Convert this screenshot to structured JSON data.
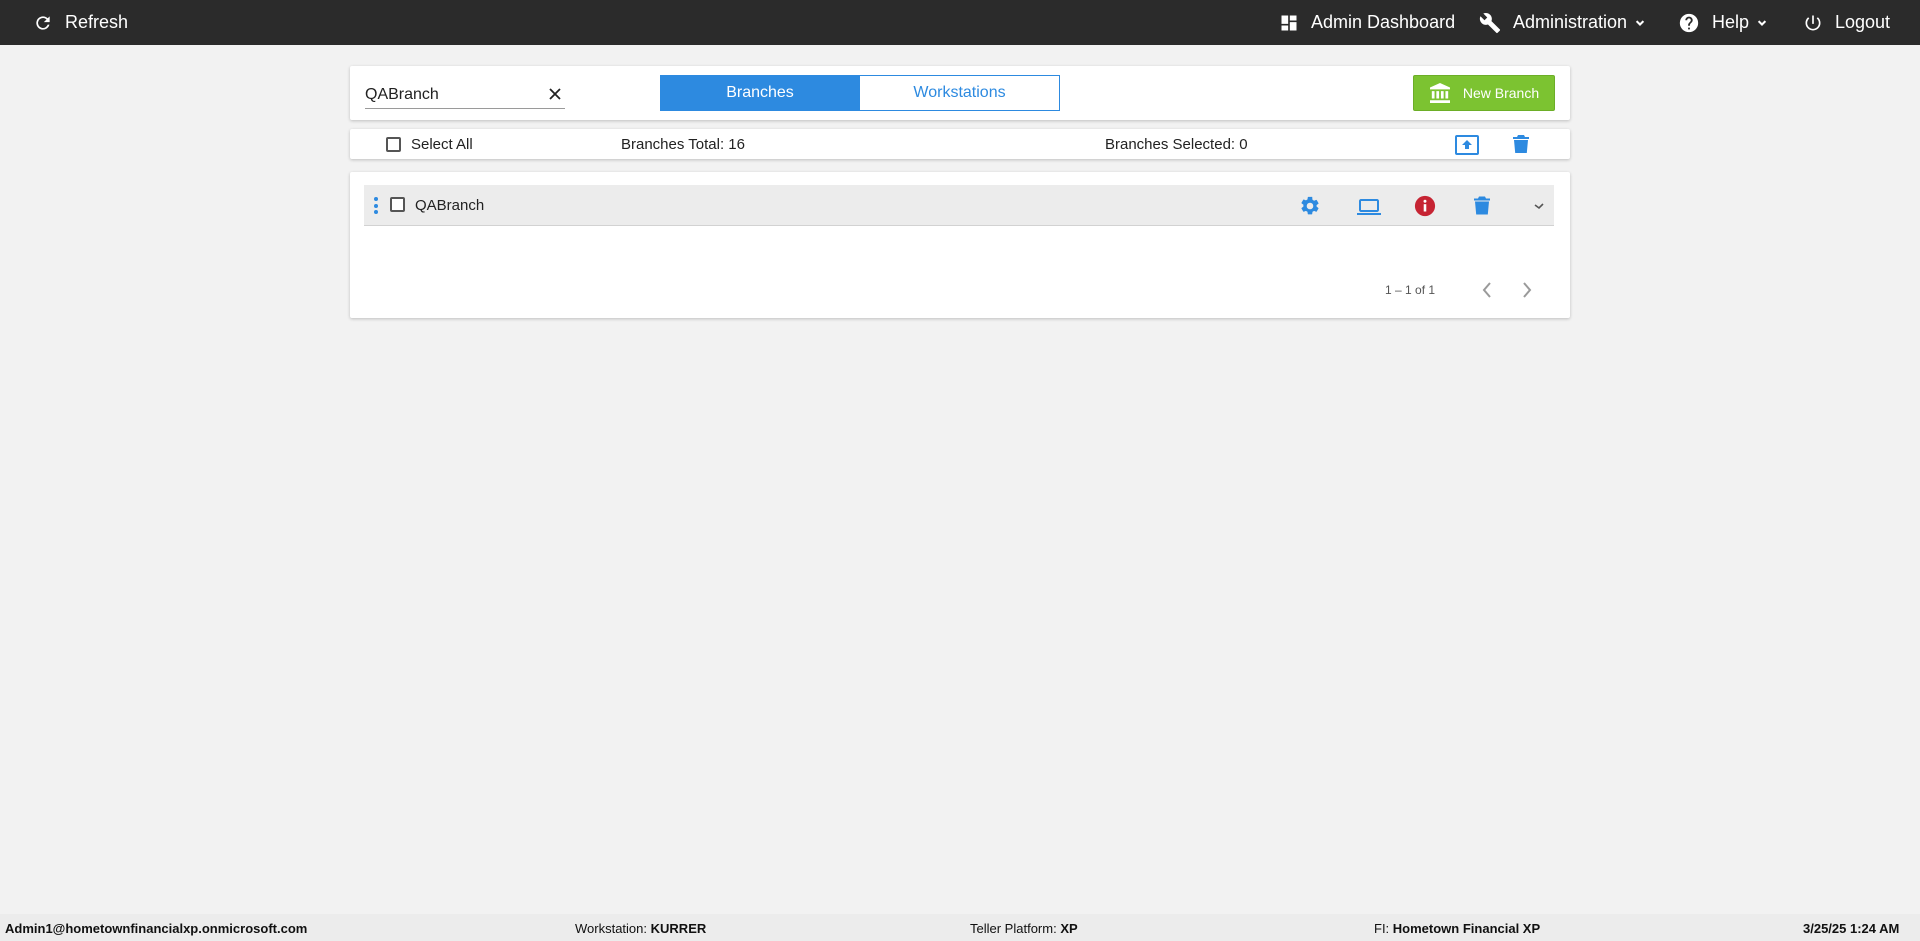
{
  "topbar": {
    "refresh_label": "Refresh",
    "admin_dashboard_label": "Admin Dashboard",
    "administration_label": "Administration",
    "help_label": "Help",
    "logout_label": "Logout",
    "background_color": "#2b2b2b"
  },
  "search": {
    "value": "QABranch",
    "clear_icon": "close-icon"
  },
  "tabs": [
    {
      "label": "Branches",
      "active": true
    },
    {
      "label": "Workstations",
      "active": false
    }
  ],
  "new_branch": {
    "label": "New Branch",
    "icon": "bank-icon",
    "color": "#7cc331"
  },
  "summary": {
    "select_all_label": "Select All",
    "total_text": "Branches Total: 16",
    "selected_text": "Branches Selected: 0",
    "upload_icon": "upload-icon",
    "delete_icon": "trash-icon"
  },
  "rows": [
    {
      "label": "QABranch",
      "checked": false,
      "icons": [
        "gear-icon",
        "laptop-icon",
        "info-icon",
        "trash-icon",
        "expand-icon"
      ]
    }
  ],
  "pagination": {
    "range_text": "1 – 1 of 1"
  },
  "status": {
    "user": "Admin1@hometownfinancialxp.onmicrosoft.com",
    "workstation_label": "Workstation:",
    "workstation_value": "KURRER",
    "platform_label": "Teller Platform:",
    "platform_value": "XP",
    "fi_label": "FI:",
    "fi_value": "Hometown Financial XP",
    "datetime": "3/25/25 1:24 AM"
  },
  "colors": {
    "accent": "#2d8ae0",
    "danger": "#c62433",
    "success": "#7cc331"
  }
}
